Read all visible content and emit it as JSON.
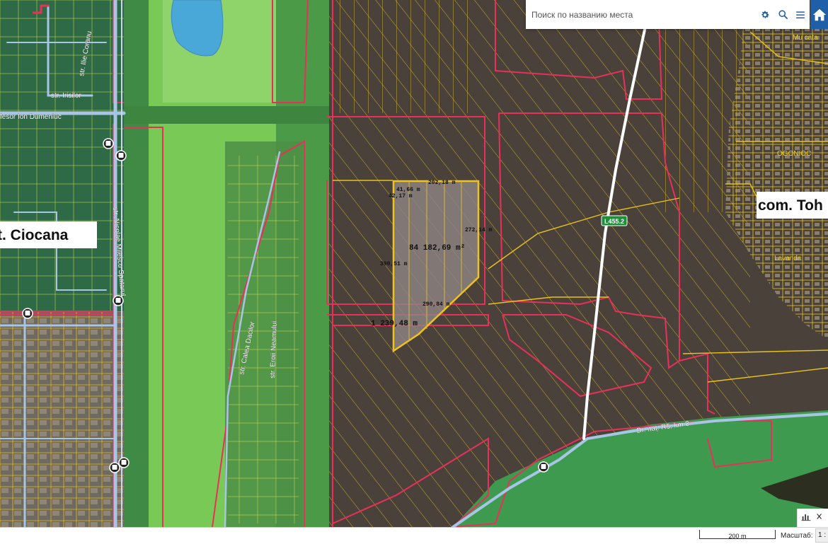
{
  "search": {
    "placeholder": "Поиск по названию места"
  },
  "labels": {
    "sector": "t. Ciocana",
    "commune": "com. Toh",
    "village": "OGONIOC",
    "lavanda": "Lavanda",
    "mucata": "Mu cata",
    "str_coranu": "str. Ilie Coranu",
    "str_irisilor": "str. Irisilor",
    "str_dumeniuc": "fesor Ion Dumeniuc",
    "str_milescu": "str. Nicolae Milescu Spatarul",
    "str_dacilor": "str. Calea Dacilor",
    "str_neamului": "str. Eroii Neamului",
    "road_r5": "Dr. naț. R5, km 8",
    "road_l455": "L455.2"
  },
  "measurements": {
    "area": "84 182,69 m²",
    "perimeter": "1 239,48 m",
    "side_top": "202,18 m",
    "side_a": "41,66 m",
    "side_b": "42,17 m",
    "side_right": "272,14 m",
    "side_left": "390,51 m",
    "side_bottom": "290,84 m"
  },
  "scale": {
    "bar_label": "200 m",
    "label": "Масштаб:",
    "value": "1 :"
  },
  "colors": {
    "accent": "#1f5fa8",
    "parcel_yellow": "#e8c21a",
    "boundary_red": "#e8305a",
    "road_blue": "#a8c4e6"
  },
  "icons": {
    "settings": "gear-icon",
    "search": "search-icon",
    "menu": "menu-icon",
    "home": "home-icon",
    "chart": "chart-icon",
    "close": "close-icon"
  }
}
